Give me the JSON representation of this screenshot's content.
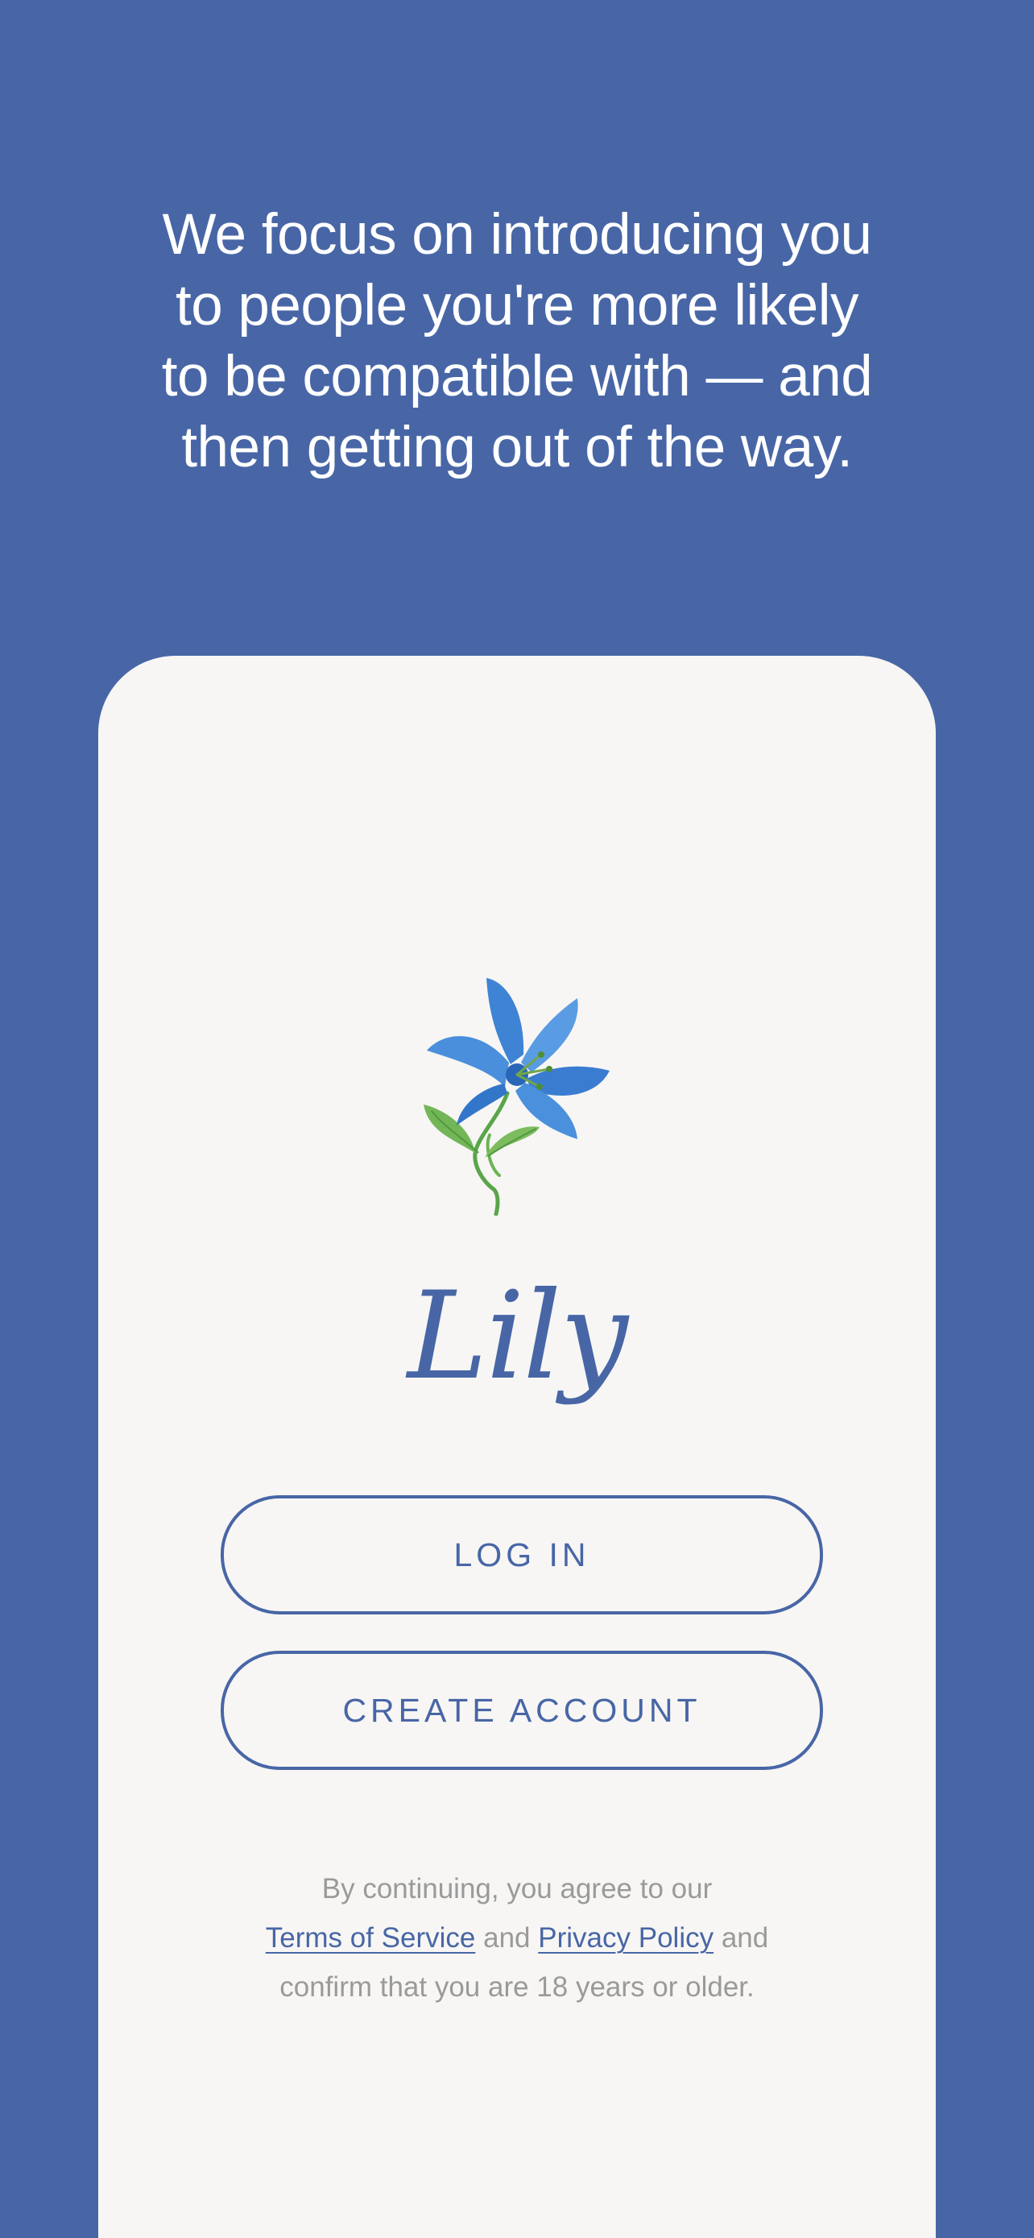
{
  "tagline": {
    "line1": "We focus on introducing you",
    "line2": "to people you're more likely",
    "line3": "to be compatible with — and",
    "line4": "then getting out of the way."
  },
  "brand": {
    "name": "Lily",
    "logo_icon": "lily-flower-icon"
  },
  "buttons": {
    "login_label": "LOG IN",
    "create_account_label": "CREATE ACCOUNT"
  },
  "legal": {
    "prefix": "By continuing, you agree to our",
    "terms_link": "Terms of Service",
    "and_1": "and",
    "privacy_link": "Privacy Policy",
    "and_2": "and",
    "suffix": "confirm that you are 18 years or older."
  },
  "colors": {
    "background": "#4866a6",
    "card": "#f7f6f4",
    "accent": "#4866a6",
    "muted_text": "#9a9a9a"
  }
}
